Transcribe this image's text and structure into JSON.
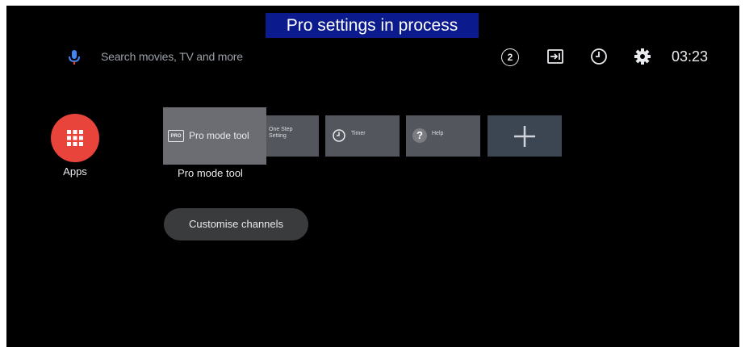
{
  "banner": {
    "text": "Pro settings in process"
  },
  "search": {
    "placeholder": "Search movies, TV and more",
    "icon": "mic-icon"
  },
  "status_bar": {
    "notifications_count": "2",
    "icons": [
      "notifications-icon",
      "input-icon",
      "timer-icon",
      "settings-icon"
    ],
    "time": "03:23"
  },
  "apps": {
    "label": "Apps",
    "color": "#e8443b"
  },
  "cards": {
    "pro_mode_tool": {
      "title": "Pro mode tool",
      "icon_text": "PRO",
      "caption": "Pro mode tool"
    },
    "one_step": {
      "title": "One Step Setting"
    },
    "timer": {
      "title": "Timer"
    },
    "help": {
      "title": "Help",
      "icon_text": "?"
    },
    "add": {
      "icon": "plus-icon"
    }
  },
  "customise": {
    "label": "Customise channels"
  },
  "colors": {
    "banner_bg": "#0b1a8c",
    "accent_blue": "#4285f4",
    "accent_red": "#e8443b",
    "card": "#53565c",
    "card_focus": "#6b6d72",
    "add_card": "#3c4652"
  }
}
